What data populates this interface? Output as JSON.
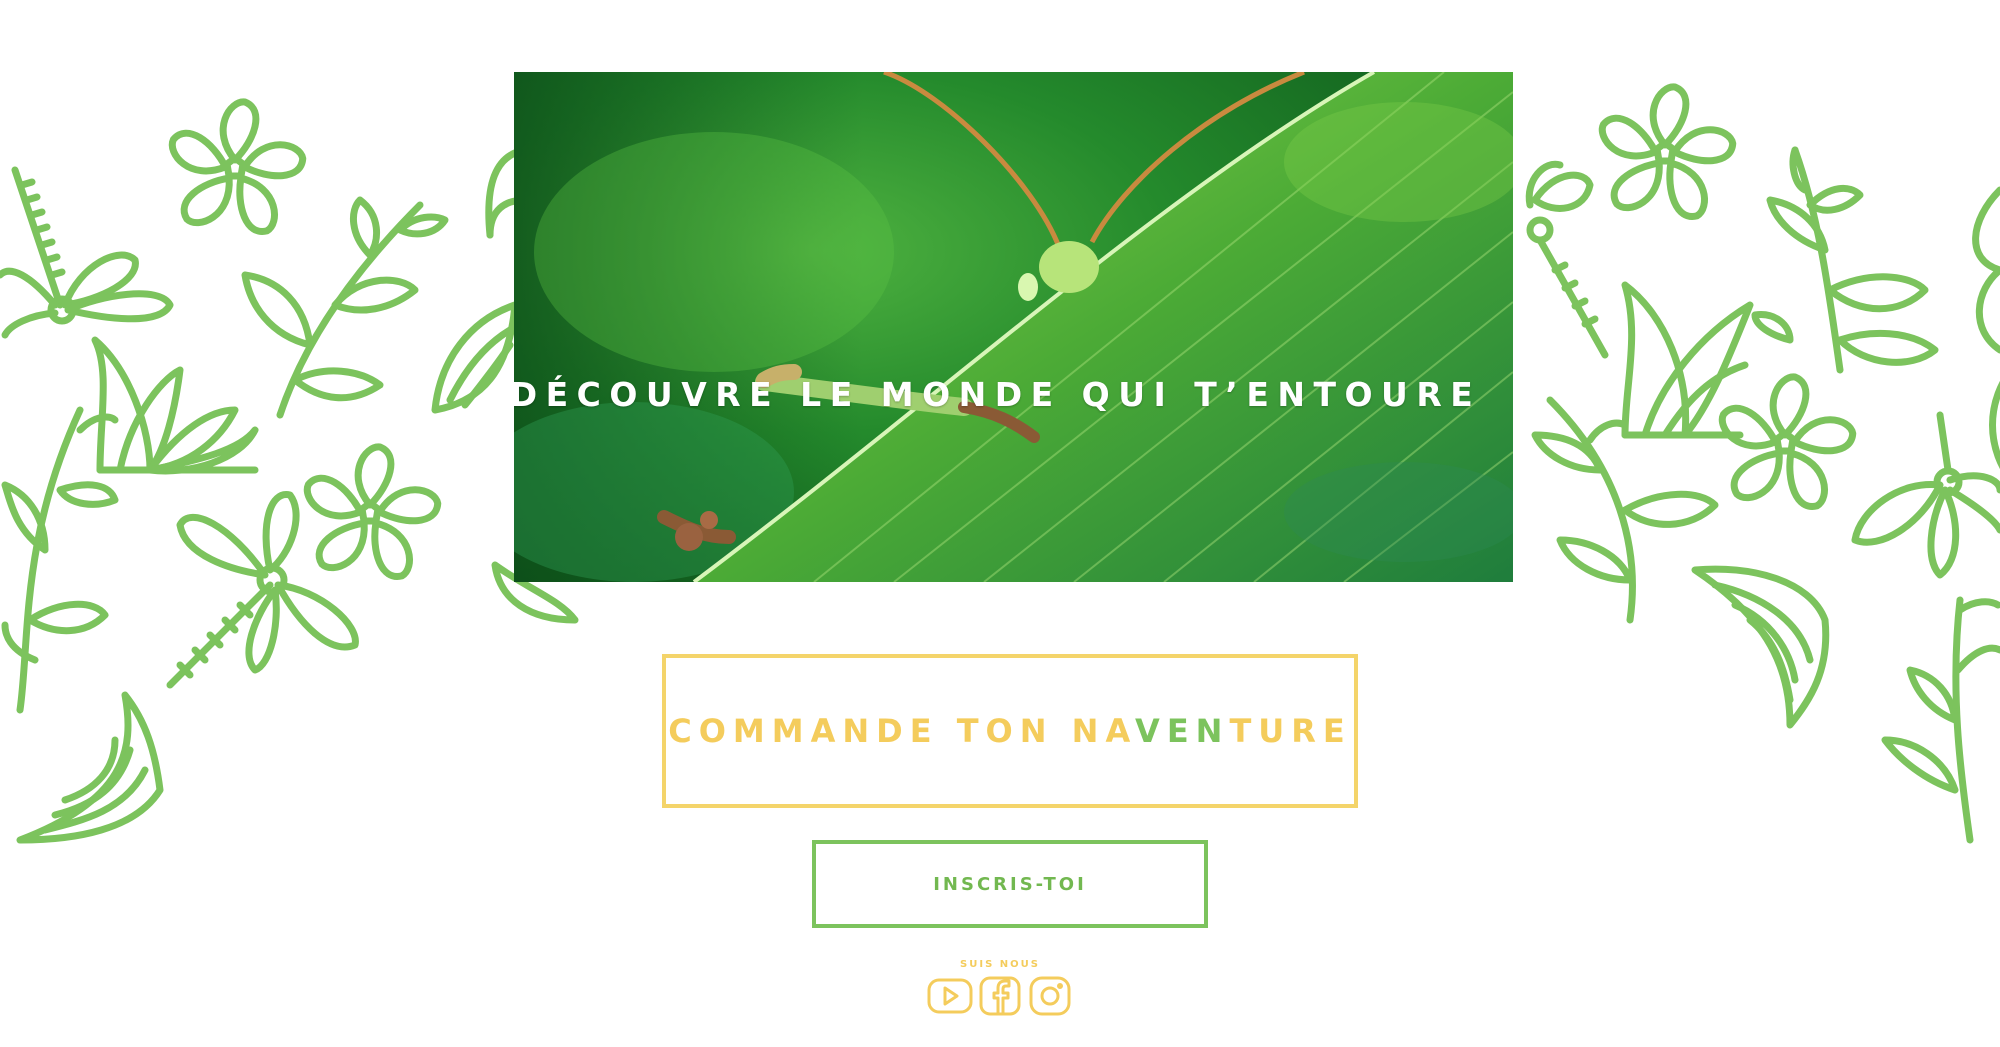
{
  "hero": {
    "title": "DÉCOUVRE LE MONDE QUI T’ENTOURE",
    "image_subject": "grasshopper-on-green-leaf"
  },
  "order": {
    "prefix": "COMMANDE TON NA",
    "accent": "VEN",
    "suffix": "TURE"
  },
  "signup": {
    "label": "INSCRIS-TOI"
  },
  "social": {
    "label": "SUIS NOUS",
    "icons": [
      "youtube-icon",
      "facebook-icon",
      "instagram-icon"
    ]
  },
  "colors": {
    "green": "#7cc35d",
    "yellow": "#f4cc5c",
    "background": "#ffffff"
  }
}
